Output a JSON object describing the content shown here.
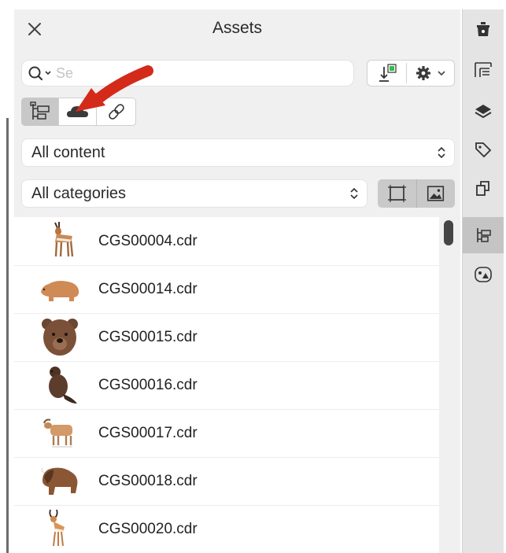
{
  "panel": {
    "title": "Assets",
    "search": {
      "placeholder": "Se"
    },
    "content_filter": {
      "selected": "All content"
    },
    "category_filter": {
      "selected": "All categories"
    },
    "source_tabs": [
      {
        "name": "local",
        "icon": "folder-tree-icon",
        "active": true
      },
      {
        "name": "cloud",
        "icon": "cloud-icon",
        "active": false
      },
      {
        "name": "linked",
        "icon": "link-icon",
        "active": false
      }
    ],
    "items": [
      {
        "name": "CGS00004.cdr",
        "icon": "antelope-icon"
      },
      {
        "name": "CGS00014.cdr",
        "icon": "bear-icon"
      },
      {
        "name": "CGS00015.cdr",
        "icon": "bear-face-icon"
      },
      {
        "name": "CGS00016.cdr",
        "icon": "beaver-icon"
      },
      {
        "name": "CGS00017.cdr",
        "icon": "goat-icon"
      },
      {
        "name": "CGS00018.cdr",
        "icon": "bison-icon"
      },
      {
        "name": "CGS00020.cdr",
        "icon": "gazelle-icon"
      }
    ]
  },
  "dock": {
    "items": [
      {
        "icon": "hint-icon"
      },
      {
        "icon": "properties-icon"
      },
      {
        "icon": "layers-icon"
      },
      {
        "icon": "tag-icon"
      },
      {
        "icon": "transform-icon"
      },
      {
        "icon": "assets-icon",
        "active": true
      },
      {
        "icon": "symbols-icon"
      }
    ]
  },
  "colors": {
    "annotation_arrow": "#d42a1a",
    "active_tab": "#c8c8c8",
    "panel_bg": "#f0f0f0"
  }
}
